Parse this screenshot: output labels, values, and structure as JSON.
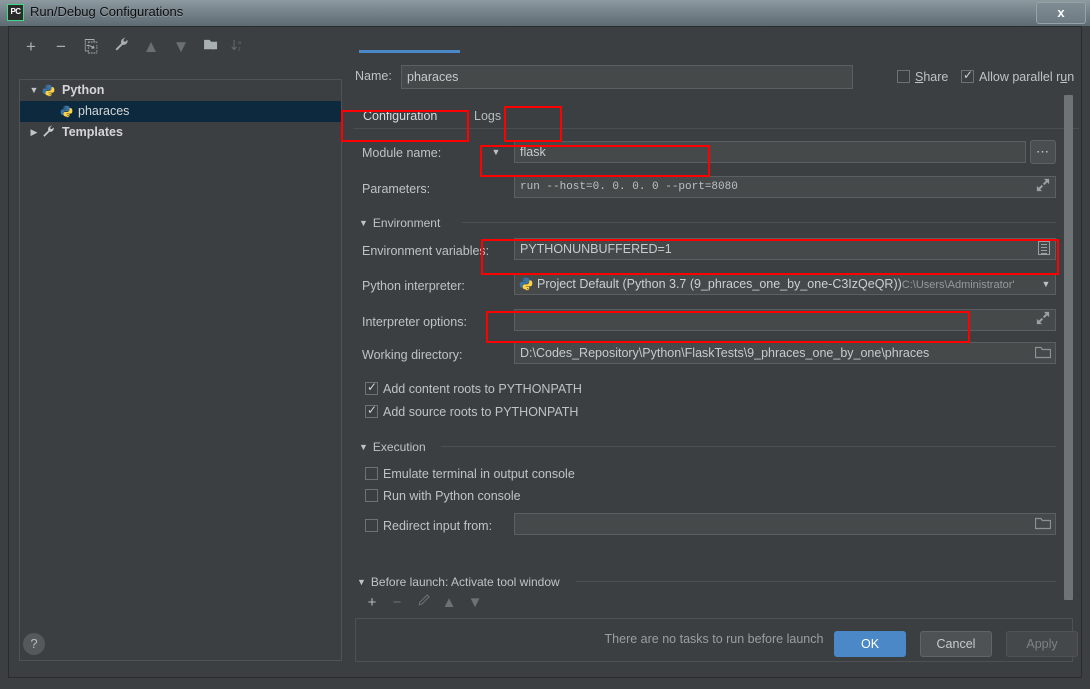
{
  "window": {
    "title": "Run/Debug Configurations",
    "app_icon_text": "PC",
    "close_label": "x"
  },
  "toolbar": {
    "items": [
      {
        "name": "add",
        "glyph": "+",
        "enabled": true
      },
      {
        "name": "remove",
        "glyph": "−",
        "enabled": true
      },
      {
        "name": "copy",
        "glyph": "⎘",
        "enabled": true
      },
      {
        "name": "edit-templates",
        "glyph": "🔧",
        "enabled": true
      },
      {
        "name": "move-up",
        "glyph": "▲",
        "enabled": false
      },
      {
        "name": "move-down",
        "glyph": "▼",
        "enabled": false
      },
      {
        "name": "new-folder",
        "glyph": "◰",
        "enabled": true
      },
      {
        "name": "sort-alphabetically",
        "glyph": "↧",
        "enabled": false
      }
    ]
  },
  "tree": {
    "items": [
      {
        "label": "Python",
        "arrow": "▼",
        "icon": "python-icon",
        "selected": false,
        "indent": 22,
        "bold": true
      },
      {
        "label": "pharaces",
        "arrow": "",
        "icon": "python-icon",
        "selected": true,
        "indent": 48,
        "bold": false
      },
      {
        "label": "Templates",
        "arrow": "▶",
        "icon": "wrench-icon",
        "selected": false,
        "indent": 22,
        "bold": true
      }
    ]
  },
  "header": {
    "name_label": "Name:",
    "name_value": "pharaces",
    "share_label_pre": "",
    "share_label_mn": "S",
    "share_label_post": "hare",
    "share_checked": false,
    "parallel_label_pre": "Allow parallel r",
    "parallel_label_mn": "u",
    "parallel_label_post": "n",
    "parallel_checked": true
  },
  "tabs": [
    {
      "label": "Configuration",
      "active": true
    },
    {
      "label": "Logs",
      "active": false
    }
  ],
  "configuration": {
    "module_name_label": "Module name:",
    "module_name_value": "flask",
    "parameters_label": "Parameters:",
    "parameters_value": "run --host=0. 0. 0. 0  --port=8080",
    "environment_section": "Environment",
    "env_vars_label": "Environment variables:",
    "env_vars_value": "PYTHONUNBUFFERED=1",
    "interpreter_label": "Python interpreter:",
    "interpreter_value": "Project Default (Python 3.7 (9_phraces_one_by_one-C3IzQeQR))",
    "interpreter_path_hint": "C:\\Users\\Administrator'",
    "interpreter_options_label": "Interpreter options:",
    "interpreter_options_value": "",
    "working_dir_label": "Working directory:",
    "working_dir_value": "D:\\Codes_Repository\\Python\\FlaskTests\\9_phraces_one_by_one\\phraces",
    "add_content_roots_label": "Add content roots to PYTHONPATH",
    "add_content_roots_checked": true,
    "add_source_roots_label": "Add source roots to PYTHONPATH",
    "add_source_roots_checked": true,
    "execution_section": "Execution",
    "emulate_terminal_label": "Emulate terminal in output console",
    "emulate_terminal_checked": false,
    "run_with_console_label": "Run with Python console",
    "run_with_console_checked": false,
    "redirect_input_label": "Redirect input from:",
    "redirect_input_checked": false,
    "redirect_input_value": ""
  },
  "before_launch": {
    "section_label": "Before launch: Activate tool window",
    "toolbar": [
      {
        "name": "add-task",
        "glyph": "+",
        "enabled": true
      },
      {
        "name": "remove-task",
        "glyph": "−",
        "enabled": false
      },
      {
        "name": "edit-task",
        "glyph": "✐",
        "enabled": false
      },
      {
        "name": "move-task-up",
        "glyph": "▲",
        "enabled": false
      },
      {
        "name": "move-task-down",
        "glyph": "▼",
        "enabled": false
      }
    ],
    "empty_text": "There are no tasks to run before launch"
  },
  "footer": {
    "help_label": "?",
    "ok_label": "OK",
    "cancel_label": "Cancel",
    "apply_label": "Apply"
  },
  "colors": {
    "accent": "#4a88c7",
    "annotation": "#ff0000",
    "background": "#3c3f41",
    "selection": "#0d293e"
  }
}
